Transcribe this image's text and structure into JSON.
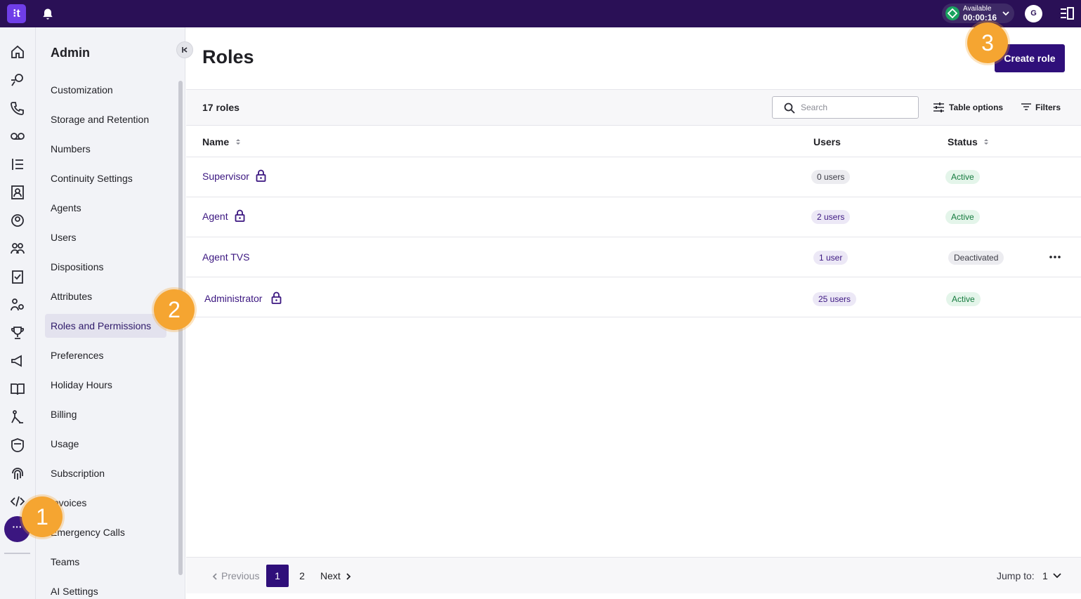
{
  "topbar": {
    "logo": "⁝t",
    "status_label": "Available",
    "status_time": "00:00:16",
    "avatar_initial": "G"
  },
  "rail": {
    "icons": [
      "home-icon",
      "conversations-icon",
      "calls-icon",
      "voicemail-icon",
      "queue-list-icon",
      "contacts-icon",
      "agent-icon",
      "team-icon",
      "tasks-icon",
      "supervisors-icon",
      "trophy-icon",
      "campaigns-icon",
      "knowledge-icon",
      "workflow-icon",
      "security-icon",
      "fingerprint-icon",
      "developer-icon"
    ],
    "more_label": "···"
  },
  "sidebar": {
    "title": "Admin",
    "items": [
      {
        "label": "Customization",
        "active": false
      },
      {
        "label": "Storage and Retention",
        "active": false
      },
      {
        "label": "Numbers",
        "active": false
      },
      {
        "label": "Continuity Settings",
        "active": false
      },
      {
        "label": "Agents",
        "active": false
      },
      {
        "label": "Users",
        "active": false
      },
      {
        "label": "Dispositions",
        "active": false
      },
      {
        "label": "Attributes",
        "active": false
      },
      {
        "label": "Roles and Permissions",
        "active": true
      },
      {
        "label": "Preferences",
        "active": false
      },
      {
        "label": "Holiday Hours",
        "active": false
      },
      {
        "label": "Billing",
        "active": false
      },
      {
        "label": "Usage",
        "active": false
      },
      {
        "label": "Subscription",
        "active": false
      },
      {
        "label": "Invoices",
        "active": false
      },
      {
        "label": "Emergency Calls",
        "active": false
      },
      {
        "label": "Teams",
        "active": false
      },
      {
        "label": "AI Settings",
        "active": false
      }
    ]
  },
  "main": {
    "title": "Roles",
    "create_button": "Create role",
    "roles_count": "17 roles",
    "search_placeholder": "Search",
    "table_options": "Table options",
    "filters": "Filters",
    "columns": {
      "name": "Name",
      "users": "Users",
      "status": "Status"
    },
    "rows": [
      {
        "name": "Supervisor",
        "locked": true,
        "users": "0 users",
        "status": "Active"
      },
      {
        "name": "Agent",
        "locked": true,
        "users": "2 users",
        "status": "Active"
      },
      {
        "name": "Agent TVS",
        "locked": false,
        "users": "1 user",
        "status": "Deactivated"
      },
      {
        "name": "Administrator",
        "locked": true,
        "users": "25 users",
        "status": "Active"
      }
    ]
  },
  "pagination": {
    "previous": "Previous",
    "pages": [
      "1",
      "2"
    ],
    "current": "1",
    "next": "Next",
    "jump_label": "Jump to:",
    "jump_value": "1"
  },
  "steps": [
    "1",
    "2",
    "3"
  ],
  "colors": {
    "brand": "#2f0f7a",
    "topbar": "#2a1056",
    "accent": "#f5a531",
    "active_green": "#157a3e"
  }
}
